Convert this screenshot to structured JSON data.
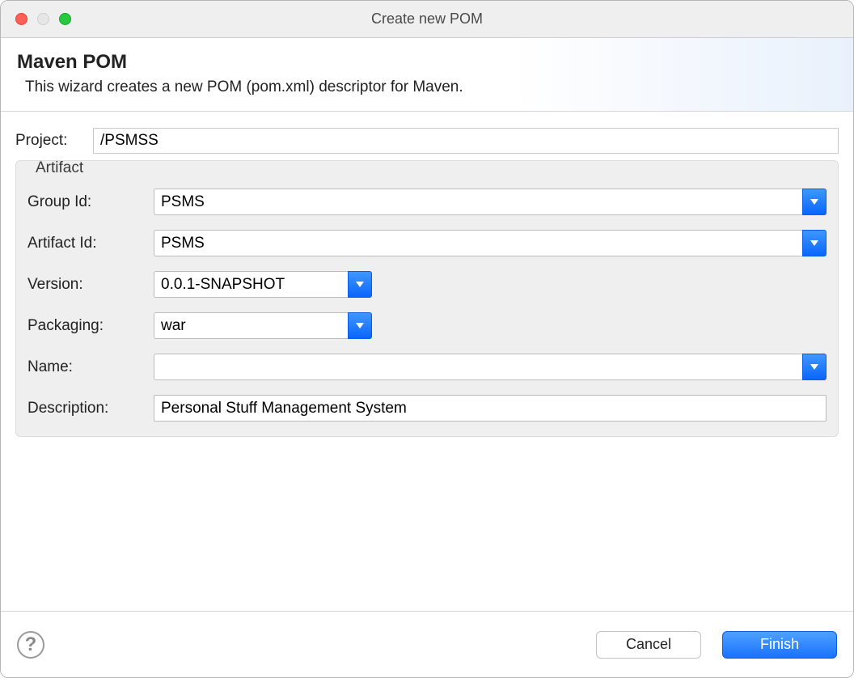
{
  "window": {
    "title": "Create new POM"
  },
  "banner": {
    "heading": "Maven POM",
    "description": "This wizard creates a new POM (pom.xml) descriptor for Maven."
  },
  "project": {
    "label": "Project:",
    "value": "/PSMSS"
  },
  "artifact": {
    "legend": "Artifact",
    "groupId": {
      "label": "Group Id:",
      "value": "PSMS"
    },
    "artifactId": {
      "label": "Artifact Id:",
      "value": "PSMS"
    },
    "version": {
      "label": "Version:",
      "value": "0.0.1-SNAPSHOT"
    },
    "packaging": {
      "label": "Packaging:",
      "value": "war"
    },
    "name": {
      "label": "Name:",
      "value": ""
    },
    "description": {
      "label": "Description:",
      "value": "Personal Stuff Management System"
    }
  },
  "buttons": {
    "cancel": "Cancel",
    "finish": "Finish"
  }
}
